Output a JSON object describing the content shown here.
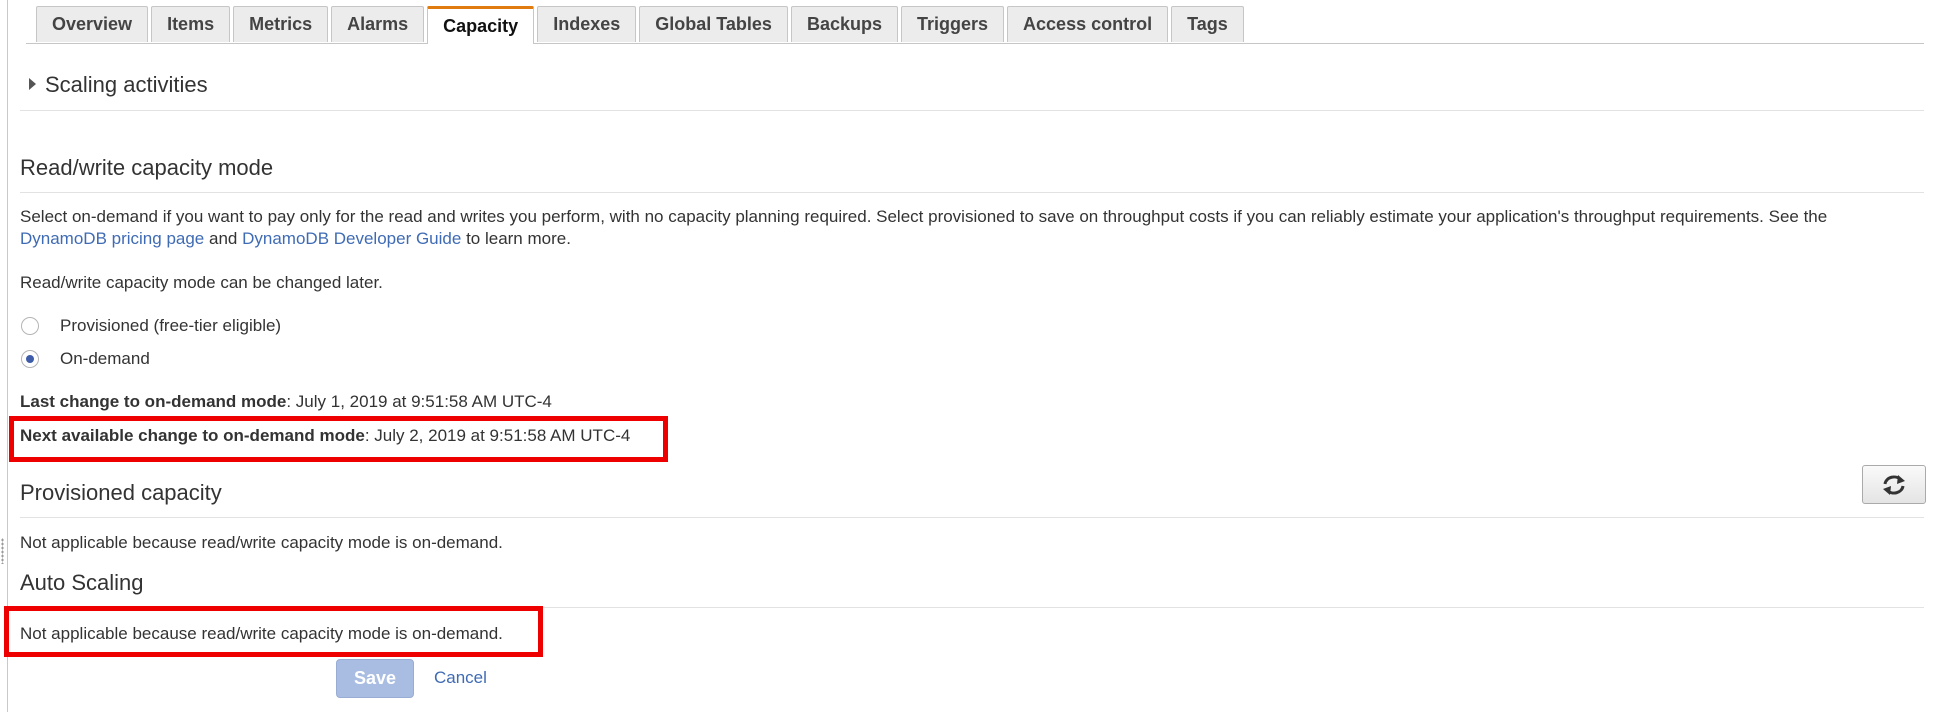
{
  "tabs": [
    {
      "label": "Overview",
      "active": false
    },
    {
      "label": "Items",
      "active": false
    },
    {
      "label": "Metrics",
      "active": false
    },
    {
      "label": "Alarms",
      "active": false
    },
    {
      "label": "Capacity",
      "active": true
    },
    {
      "label": "Indexes",
      "active": false
    },
    {
      "label": "Global Tables",
      "active": false
    },
    {
      "label": "Backups",
      "active": false
    },
    {
      "label": "Triggers",
      "active": false
    },
    {
      "label": "Access control",
      "active": false
    },
    {
      "label": "Tags",
      "active": false
    }
  ],
  "scaling": {
    "label": "Scaling activities",
    "icon": "caret-right-icon"
  },
  "rw_mode": {
    "heading": "Read/write capacity mode",
    "desc_part1": "Select on-demand if you want to pay only for the read and writes you perform, with no capacity planning required. Select provisioned to save on throughput costs if you can reliably estimate your application's throughput requirements. See the",
    "link_pricing": "DynamoDB pricing page",
    "and_text": "and",
    "link_guide": "DynamoDB Developer Guide",
    "desc_part2": "to learn more.",
    "note": "Read/write capacity mode can be changed later.",
    "options": [
      {
        "label": "Provisioned (free-tier eligible)",
        "selected": false
      },
      {
        "label": "On-demand",
        "selected": true
      }
    ],
    "last_change_label": "Last change to on-demand mode",
    "last_change_value": ": July 1, 2019 at 9:51:58 AM UTC-4",
    "next_change_label": "Next available change to on-demand mode",
    "next_change_value": ": July 2, 2019 at 9:51:58 AM UTC-4"
  },
  "provisioned": {
    "heading": "Provisioned capacity",
    "text": "Not applicable because read/write capacity mode is on-demand.",
    "refresh_icon": "refresh-icon"
  },
  "auto_scaling": {
    "heading": "Auto Scaling",
    "text": "Not applicable because read/write capacity mode is on-demand."
  },
  "actions": {
    "save": "Save",
    "cancel": "Cancel"
  },
  "colors": {
    "highlight": "#ee0000",
    "active_tab_accent": "#e07b0f",
    "link": "#3f6bb5",
    "save_disabled": "#a9bde2"
  }
}
